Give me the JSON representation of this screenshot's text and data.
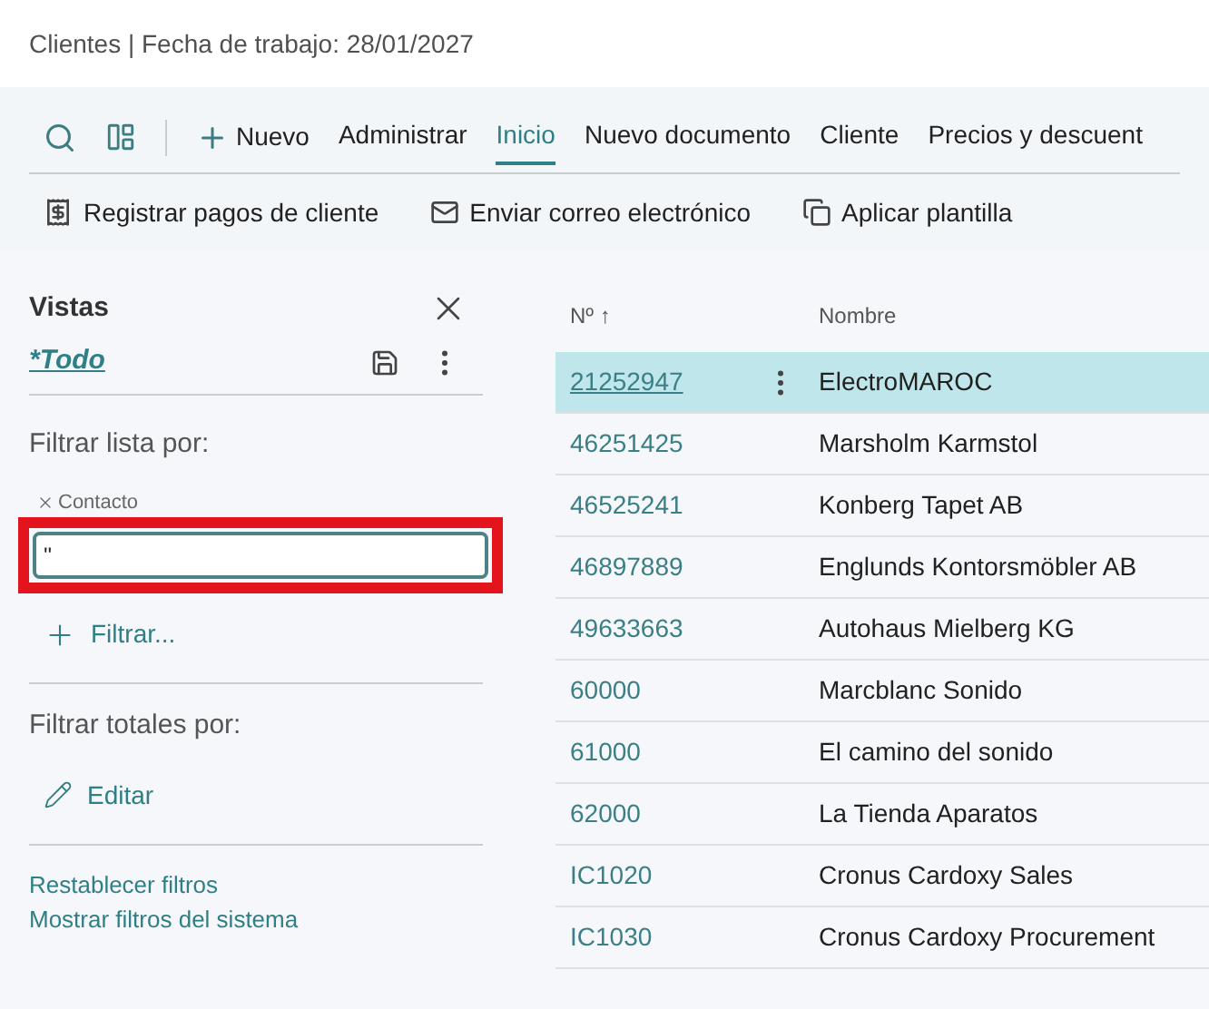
{
  "page_title": "Clientes | Fecha de trabajo: 28/01/2027",
  "nav": [
    {
      "label": "Nuevo",
      "kind": "new",
      "selected": false
    },
    {
      "label": "Administrar",
      "kind": "tab",
      "selected": false
    },
    {
      "label": "Inicio",
      "kind": "tab",
      "selected": true
    },
    {
      "label": "Nuevo documento",
      "kind": "tab",
      "selected": false
    },
    {
      "label": "Cliente",
      "kind": "tab",
      "selected": false
    },
    {
      "label": "Precios y descuent",
      "kind": "tab",
      "selected": false
    }
  ],
  "actions": [
    {
      "label": "Registrar pagos de cliente",
      "kind": "payments"
    },
    {
      "label": "Enviar correo electrónico",
      "kind": "email"
    },
    {
      "label": "Aplicar plantilla",
      "kind": "template"
    }
  ],
  "views": {
    "title": "Vistas",
    "current": "*Todo"
  },
  "filter_list": {
    "title": "Filtrar lista por:",
    "field_label": "Contacto",
    "value": "''",
    "highlighted": true,
    "add": "Filtrar..."
  },
  "filter_totals": {
    "title": "Filtrar totales por:",
    "edit": "Editar"
  },
  "links": [
    "Restablecer filtros",
    "Mostrar filtros del sistema"
  ],
  "table": {
    "columns": [
      "Nº ↑",
      "Nombre"
    ],
    "rows": [
      {
        "no": "21252947",
        "name": "ElectroMAROC",
        "selected": true
      },
      {
        "no": "46251425",
        "name": "Marsholm Karmstol",
        "selected": false
      },
      {
        "no": "46525241",
        "name": "Konberg Tapet AB",
        "selected": false
      },
      {
        "no": "46897889",
        "name": "Englunds Kontorsmöbler AB",
        "selected": false
      },
      {
        "no": "49633663",
        "name": "Autohaus Mielberg KG",
        "selected": false
      },
      {
        "no": "60000",
        "name": "Marcblanc Sonido",
        "selected": false
      },
      {
        "no": "61000",
        "name": "El camino del sonido",
        "selected": false
      },
      {
        "no": "62000",
        "name": "La Tienda Aparatos",
        "selected": false
      },
      {
        "no": "IC1020",
        "name": "Cronus Cardoxy Sales",
        "selected": false
      },
      {
        "no": "IC1030",
        "name": "Cronus Cardoxy Procurement",
        "selected": false
      }
    ]
  }
}
